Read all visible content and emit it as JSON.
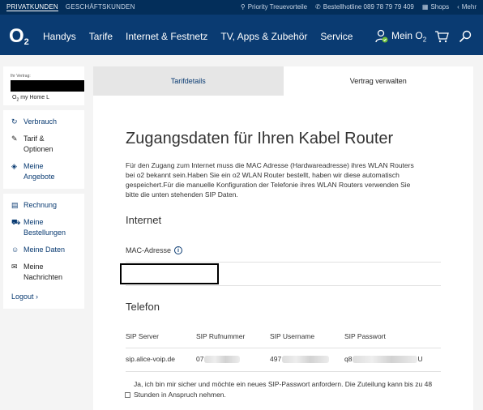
{
  "utilbar": {
    "privat": "PRIVATKUNDEN",
    "geschaeft": "GESCHÄFTSKUNDEN",
    "priority": "Priority Treuevorteile",
    "hotline": "Bestellhotline 089 78 79 79 409",
    "shops": "Shops",
    "mehr": "Mehr"
  },
  "nav": {
    "logo": "O",
    "logo_sub": "2",
    "items": [
      "Handys",
      "Tarife",
      "Internet & Festnetz",
      "TV, Apps & Zubehör",
      "Service"
    ],
    "mein": "Mein O",
    "mein_sub": "2"
  },
  "sidebar": {
    "vertrag_label": "Ihr Vertrag:",
    "vertrag_name": "O",
    "vertrag_name_rest": "my Home L",
    "group1": [
      {
        "icon": "refresh-icon",
        "label": "Verbrauch"
      },
      {
        "icon": "pencil-icon",
        "label": "Tarif &",
        "label2": "Optionen"
      },
      {
        "icon": "tag-icon",
        "label": "Meine",
        "label2": "Angebote"
      }
    ],
    "group2": [
      {
        "icon": "invoice-icon",
        "label": "Rechnung"
      },
      {
        "icon": "cart-icon",
        "label": "Meine",
        "label2": "Bestellungen"
      },
      {
        "icon": "user-icon",
        "label": "Meine Daten"
      },
      {
        "icon": "messages-icon",
        "label": "Meine",
        "label2": "Nachrichten"
      }
    ],
    "logout": "Logout ›"
  },
  "tabs": {
    "tarifdetails": "Tarifdetails",
    "verwalten": "Vertrag verwalten"
  },
  "main": {
    "title": "Zugangsdaten für Ihren Kabel Router",
    "intro": "Für den Zugang zum Internet muss die MAC Adresse (Hardwareadresse) ihres WLAN Routers bei o2 bekannt sein.Haben Sie ein o2 WLAN Router bestellt, haben wir diese automatisch gespeichert.Für die manuelle Konfiguration der Telefonie ihres WLAN Routers verwenden Sie bitte die unten stehenden SIP Daten.",
    "internet_heading": "Internet",
    "mac_label": "MAC-Adresse",
    "info_symbol": "i",
    "telefon_heading": "Telefon",
    "sip_headers": [
      "SIP Server",
      "SIP Rufnummer",
      "SIP Username",
      "SIP Passwort"
    ],
    "sip_server": "sip.alice-voip.de",
    "sip_rufnummer_prefix": "07",
    "sip_username_prefix": "497",
    "sip_passwort_prefix": "q8",
    "sip_passwort_suffix": "U",
    "checkbox_text": "Ja, ich bin mir sicher und möchte ein neues SIP-Passwort anfordern. Die Zuteilung kann bis zu 48 Stunden in Anspruch nehmen."
  },
  "colors": {
    "navy": "#0a3b72",
    "utility_bar": "#032e5a",
    "accent_green": "#6fbf3b"
  }
}
